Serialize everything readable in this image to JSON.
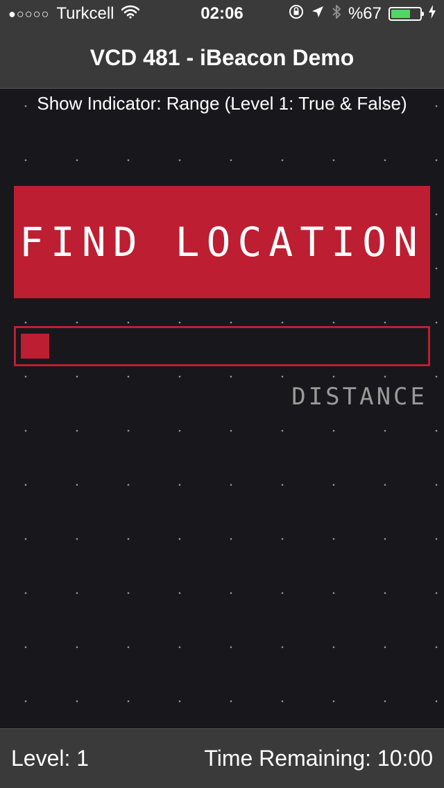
{
  "status_bar": {
    "signal": "●○○○○",
    "carrier": "Turkcell",
    "time": "02:06",
    "battery_percent": "%67",
    "battery_level": 0.67,
    "icons": [
      "wifi-icon",
      "orientation-lock-icon",
      "location-icon",
      "bluetooth-icon",
      "battery-icon",
      "charging-icon"
    ]
  },
  "nav": {
    "title": "VCD 481 - iBeacon Demo"
  },
  "main": {
    "indicator_text": "Show Indicator: Range (Level 1: True & False)",
    "find_button_label": "FIND LOCATION",
    "distance_label": "DISTANCE",
    "distance_progress": 0.07
  },
  "footer": {
    "level": "Level: 1",
    "time_remaining": "Time Remaining: 10:00"
  },
  "colors": {
    "accent": "#bd1e31",
    "background": "#18171c",
    "bars": "#3a3a3a",
    "battery": "#4cd964"
  }
}
